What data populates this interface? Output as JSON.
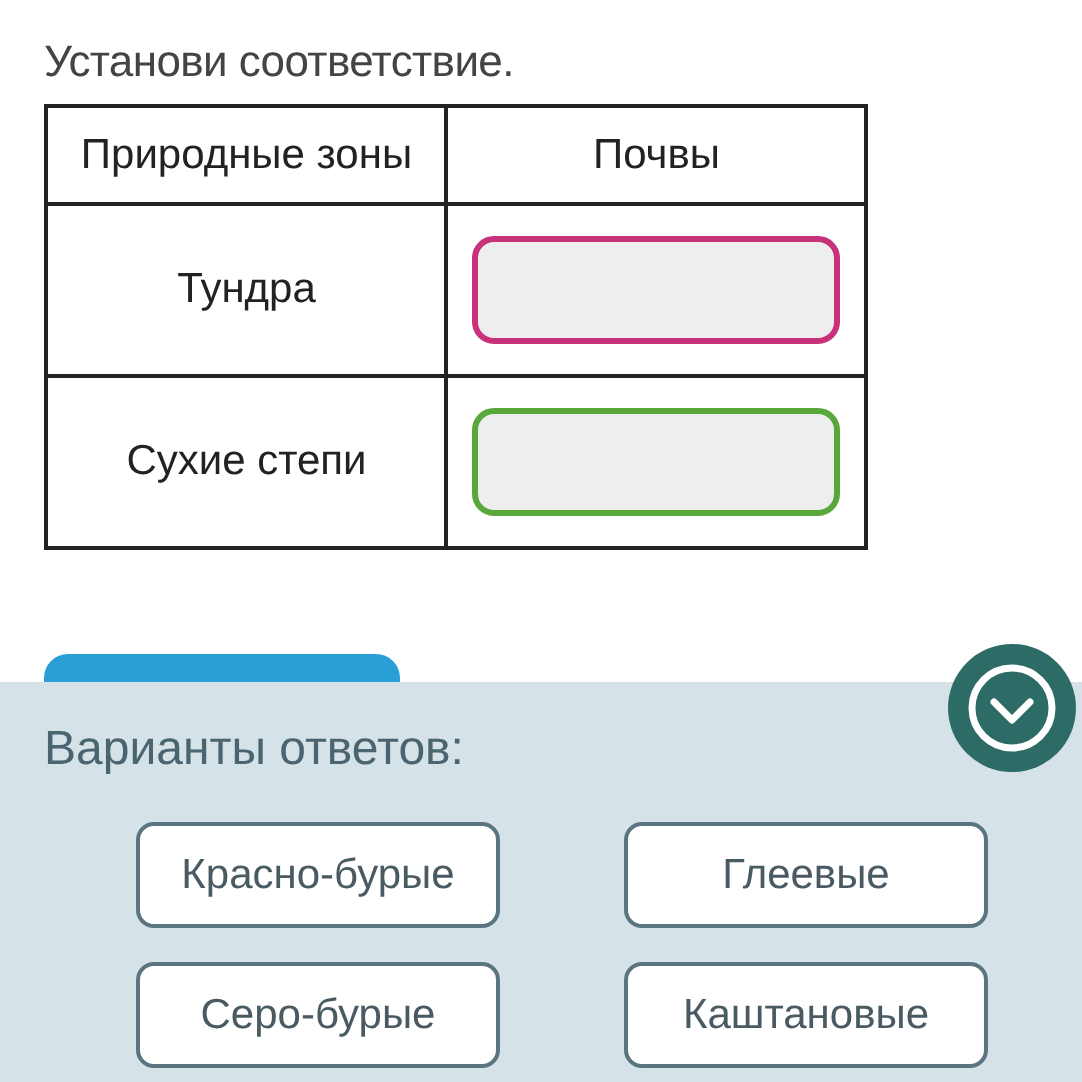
{
  "instruction": "Установи соответствие.",
  "table": {
    "columns": [
      "Природные зоны",
      "Почвы"
    ],
    "rows": [
      {
        "zone": "Тундра",
        "color": "#c8327a"
      },
      {
        "zone": "Сухие степи",
        "color": "#5aa83c"
      }
    ]
  },
  "answers": {
    "title": "Варианты ответов:",
    "options": [
      "Красно-бурые",
      "Глеевые",
      "Серо-бурые",
      "Каштановые"
    ]
  }
}
